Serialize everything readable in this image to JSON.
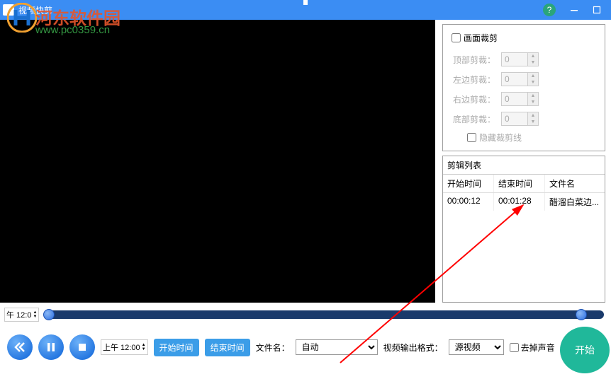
{
  "titlebar": {
    "title": "视频快剪"
  },
  "watermark": {
    "text": "河东软件园",
    "url": "www.pc0359.cn"
  },
  "crop": {
    "header": "画面裁剪",
    "top": {
      "label": "顶部剪裁：",
      "value": "0"
    },
    "left": {
      "label": "左边剪裁：",
      "value": "0"
    },
    "right": {
      "label": "右边剪裁：",
      "value": "0"
    },
    "bottom": {
      "label": "底部剪裁：",
      "value": "0"
    },
    "hide": "隐藏裁剪线"
  },
  "editlist": {
    "title": "剪辑列表",
    "headers": {
      "start": "开始时间",
      "end": "结束时间",
      "file": "文件名"
    },
    "rows": [
      {
        "start": "00:00:12",
        "end": "00:01:28",
        "file": "醋溜白菜边..."
      }
    ]
  },
  "timeline": {
    "left_time": "午 12:0"
  },
  "controls": {
    "time_input": "上午 12:00",
    "mark_start": "开始时间",
    "mark_end": "结束时间",
    "filename_label": "文件名：",
    "filename_value": "自动",
    "format_label": "视频输出格式：",
    "format_value": "源视频",
    "mute": "去掉声音",
    "start": "开始"
  },
  "chart_data": null
}
